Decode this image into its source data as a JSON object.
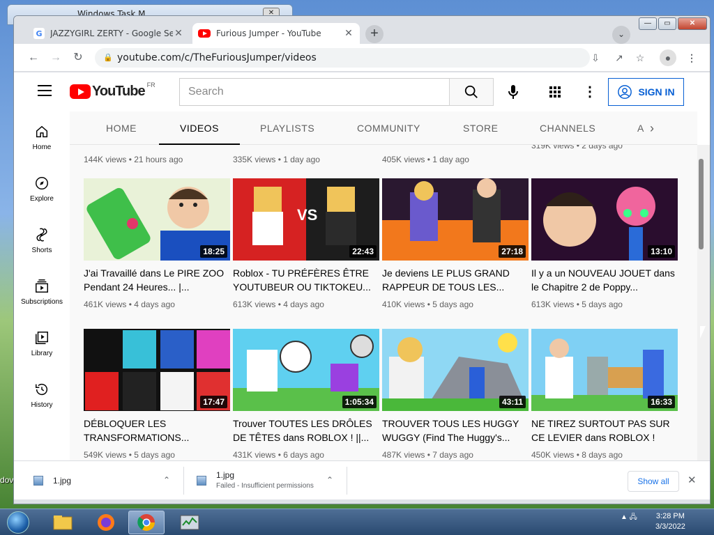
{
  "background_window": {
    "title": "Windows Task M..."
  },
  "desktop_text": "dov",
  "browser": {
    "tabs": [
      {
        "label": "JAZZYGIRL ZERTY - Google Searc",
        "favicon": "google-icon"
      },
      {
        "label": "Furious Jumper - YouTube",
        "favicon": "youtube-icon"
      }
    ],
    "url": "youtube.com/c/TheFuriousJumper/videos"
  },
  "youtube": {
    "logo_text": "YouTube",
    "region": "FR",
    "search_placeholder": "Search",
    "sign_in": "SIGN IN",
    "guide": [
      {
        "label": "Home",
        "icon": "home-icon"
      },
      {
        "label": "Explore",
        "icon": "explore-icon"
      },
      {
        "label": "Shorts",
        "icon": "shorts-icon"
      },
      {
        "label": "Subscriptions",
        "icon": "subscriptions-icon"
      },
      {
        "label": "Library",
        "icon": "library-icon"
      },
      {
        "label": "History",
        "icon": "history-icon"
      }
    ],
    "channel_tabs": [
      "HOME",
      "VIDEOS",
      "PLAYLISTS",
      "COMMUNITY",
      "STORE",
      "CHANNELS",
      "A"
    ],
    "prev_row_meta": [
      "144K views • 21 hours ago",
      "335K views • 1 day ago",
      "405K views • 1 day ago",
      "319K views • 2 days ago"
    ],
    "videos": [
      {
        "title": "J'ai Travaillé dans Le PIRE ZOO Pendant 24 Heures... |...",
        "duration": "18:25",
        "meta": "461K views • 4 days ago"
      },
      {
        "title": "Roblox - TU PRÉFÈRES ÊTRE YOUTUBEUR OU TIKTOKEU...",
        "duration": "22:43",
        "meta": "613K views • 4 days ago"
      },
      {
        "title": "Je deviens LE PLUS GRAND RAPPEUR DE TOUS LES...",
        "duration": "27:18",
        "meta": "410K views • 5 days ago"
      },
      {
        "title": "Il y a un NOUVEAU JOUET dans le Chapitre 2 de Poppy...",
        "duration": "13:10",
        "meta": "613K views • 5 days ago"
      },
      {
        "title": "DÉBLOQUER LES TRANSFORMATIONS...",
        "duration": "17:47",
        "meta": "549K views • 5 days ago"
      },
      {
        "title": "Trouver TOUTES LES DRÔLES DE TÊTES dans ROBLOX ! ||...",
        "duration": "1:05:34",
        "meta": "431K views • 6 days ago"
      },
      {
        "title": "TROUVER TOUS LES HUGGY WUGGY (Find The Huggy's...",
        "duration": "43:11",
        "meta": "487K views • 7 days ago"
      },
      {
        "title": "NE TIREZ SURTOUT PAS SUR CE LEVIER dans ROBLOX !",
        "duration": "16:33",
        "meta": "450K views • 8 days ago"
      }
    ]
  },
  "downloads": [
    {
      "name": "1.jpg",
      "status": ""
    },
    {
      "name": "1.jpg",
      "status": "Failed - Insufficient permissions"
    }
  ],
  "show_all": "Show all",
  "clock": {
    "time": "3:28 PM",
    "date": "3/3/2022"
  },
  "colors": {
    "youtube_red": "#ff0000",
    "signin_blue": "#065fd4"
  }
}
